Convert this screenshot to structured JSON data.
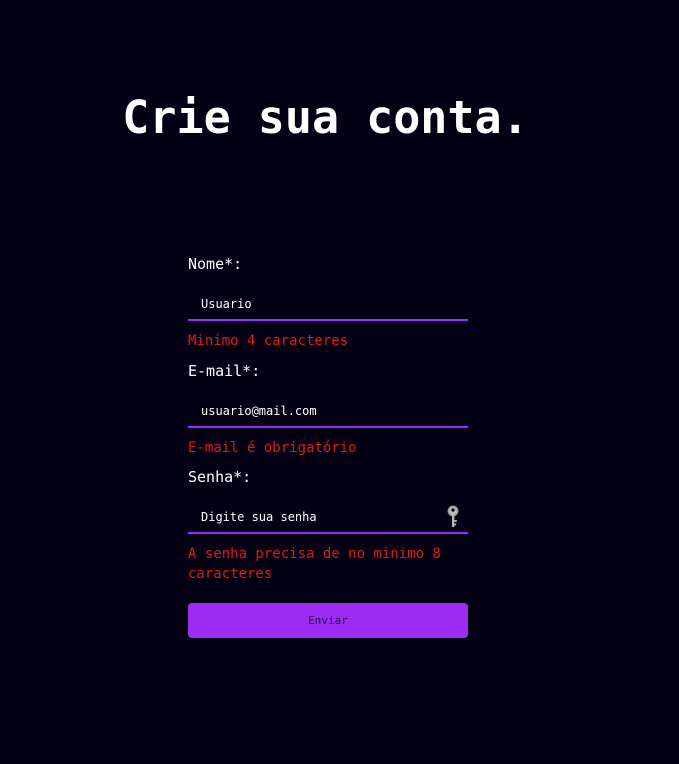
{
  "page": {
    "title": "Crie sua conta."
  },
  "form": {
    "name": {
      "label": "Nome*:",
      "value": "Usuario",
      "error": "Minimo 4 caracteres"
    },
    "email": {
      "label": "E-mail*:",
      "value": "usuario@mail.com",
      "error": "E-mail é obrigatório"
    },
    "password": {
      "label": "Senha*:",
      "placeholder": "Digite sua senha",
      "icon": "key-icon",
      "error": "A senha precisa de no minimo 8 caracteres"
    },
    "submit_label": "Enviar"
  },
  "colors": {
    "background": "#030014",
    "accent": "#9b2cf2",
    "error": "#e01a1a",
    "text": "#ffffff"
  }
}
